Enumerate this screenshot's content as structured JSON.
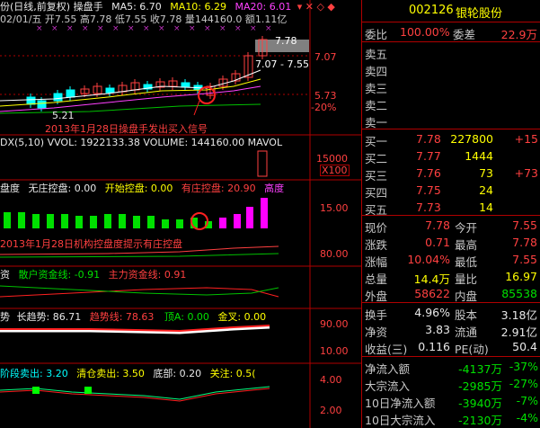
{
  "header": {
    "line1_title": "份(日线,前复权) 操盘手",
    "ma5": "MA5: 6.70",
    "ma10": "MA10: 6.29",
    "ma20": "MA20: 6.01",
    "ohlc": "02/01/五 开7.55 高7.78 低7.55 收7.78 量144160.0 额1.11亿"
  },
  "price_axis": {
    "top_box_price": "7.78",
    "range_label": "7.07 - 7.55",
    "p1": "7.07",
    "p2": "5.73",
    "p3": "-20%",
    "low_price": "5.21",
    "annotation": "2013年1月28日操盘手发出买入信号"
  },
  "vol_panel": {
    "title": "DX(5,10) VVOL: 1922133.38   VOLUME: 144160.00  MAVOL",
    "axis": "15000",
    "unit": "X100"
  },
  "control_panel": {
    "title": "盘度",
    "no_control": "无庄控盘: 0.00",
    "start_control": "开始控盘: 0.00",
    "has_control": "有庄控盘: 20.90",
    "high": "高度",
    "axis_top": "15.00",
    "axis_bottom": "80.00",
    "annotation": "2013年1月28日机构控盘度提示有庄控盘"
  },
  "funds_panel": {
    "title": "资",
    "retail": "散户资金线: -0.91",
    "main": "主力资金线: 0.91"
  },
  "trend_panel": {
    "title": "势",
    "long": "长趋势: 86.71",
    "trend": "趋势线: 78.63",
    "top": "顶A: 0.00",
    "gold": "金叉: 0.00",
    "axis_top": "90.00",
    "axis_bottom": "10.00"
  },
  "stage_panel": {
    "sell": "阶段卖出: 3.20",
    "clear": "清仓卖出: 3.50",
    "bottom": "底部: 0.20",
    "focus": "关注: 0.5(",
    "axis_top": "4.00",
    "axis_bottom": "2.00"
  },
  "quote": {
    "code": "002126",
    "name": "银轮股份",
    "wei_bi_label": "委比",
    "wei_bi": "100.00%",
    "wei_cha_label": "委差",
    "wei_cha": "22.9万",
    "sell_labels": [
      "卖五",
      "卖四",
      "卖三",
      "卖二",
      "卖一"
    ],
    "buy": [
      {
        "label": "买一",
        "price": "7.78",
        "vol": "227800",
        "chg": "+15"
      },
      {
        "label": "买二",
        "price": "7.77",
        "vol": "1444",
        "chg": ""
      },
      {
        "label": "买三",
        "price": "7.76",
        "vol": "73",
        "chg": "+73"
      },
      {
        "label": "买四",
        "price": "7.75",
        "vol": "24",
        "chg": ""
      },
      {
        "label": "买五",
        "price": "7.73",
        "vol": "14",
        "chg": ""
      }
    ],
    "stats": [
      {
        "l1": "现价",
        "v1": "7.78",
        "l2": "今开",
        "v2": "7.55"
      },
      {
        "l1": "涨跌",
        "v1": "0.71",
        "l2": "最高",
        "v2": "7.78"
      },
      {
        "l1": "涨幅",
        "v1": "10.04%",
        "l2": "最低",
        "v2": "7.55"
      },
      {
        "l1": "总量",
        "v1": "14.4万",
        "l2": "量比",
        "v2": "16.97"
      },
      {
        "l1": "外盘",
        "v1": "58622",
        "l2": "内盘",
        "v2": "85538"
      }
    ],
    "stats2": [
      {
        "l1": "换手",
        "v1": "4.96%",
        "l2": "股本",
        "v2": "3.18亿"
      },
      {
        "l1": "净资",
        "v1": "3.83",
        "l2": "流通",
        "v2": "2.91亿"
      },
      {
        "l1": "收益(三)",
        "v1": "0.116",
        "l2": "PE(动)",
        "v2": "50.4"
      }
    ],
    "flows": [
      {
        "label": "净流入额",
        "val": "-4137万",
        "pct": "-37%"
      },
      {
        "label": "大宗流入",
        "val": "-2985万",
        "pct": "-27%"
      },
      {
        "label": "10日净流入额",
        "val": "-3940万",
        "pct": "-7%"
      },
      {
        "label": "10日大宗流入",
        "val": "-2130万",
        "pct": "-4%"
      }
    ]
  }
}
